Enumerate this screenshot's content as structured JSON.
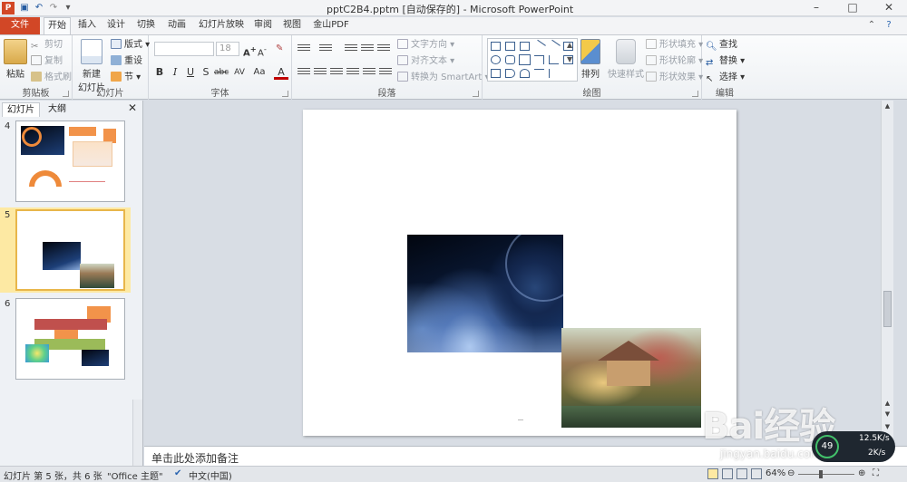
{
  "titlebar": {
    "title": "pptC2B4.pptm [自动保存的] - Microsoft PowerPoint",
    "app_icon": "P"
  },
  "tabs": [
    "文件",
    "开始",
    "插入",
    "设计",
    "切换",
    "动画",
    "幻灯片放映",
    "审阅",
    "视图",
    "金山PDF"
  ],
  "ribbon": {
    "clipboard": {
      "paste": "粘贴",
      "cut": "剪切",
      "copy": "复制",
      "format_painter": "格式刷",
      "label": "剪贴板"
    },
    "slides": {
      "new_slide": "新建",
      "new_slide_2": "幻灯片",
      "layout": "版式",
      "reset": "重设",
      "section": "节",
      "label": "幻灯片"
    },
    "font": {
      "size": "18",
      "label": "字体",
      "bold": "B",
      "italic": "I",
      "underline": "U",
      "shadow": "S",
      "strike": "abc",
      "spacing": "AV",
      "case": "Aa",
      "color": "A"
    },
    "paragraph": {
      "text_direction": "文字方向",
      "align_text": "对齐文本",
      "smartart": "转换为 SmartArt",
      "label": "段落"
    },
    "drawing": {
      "arrange": "排列",
      "quick_styles": "快速样式",
      "shape_fill": "形状填充",
      "shape_outline": "形状轮廓",
      "shape_effects": "形状效果",
      "label": "绘图"
    },
    "editing": {
      "find": "查找",
      "replace": "替换",
      "select": "选择",
      "label": "编辑"
    }
  },
  "left_panel": {
    "tab_slides": "幻灯片",
    "tab_outline": "大纲",
    "thumbnails": [
      {
        "number": "4",
        "selected": false
      },
      {
        "number": "5",
        "selected": true
      },
      {
        "number": "6",
        "selected": false
      }
    ]
  },
  "notes": {
    "placeholder": "单击此处添加备注"
  },
  "statusbar": {
    "slide_info": "幻灯片 第 5 张，共 6 张",
    "theme": "\"Office 主题\"",
    "language": "中文(中国)",
    "zoom": "64%"
  },
  "watermark": {
    "brand": "Bai经验",
    "domain": "jingyan.baidu.com"
  },
  "network_widget": {
    "percent": "49",
    "upload": "12.5K/s",
    "download": "2K/s"
  },
  "colors": {
    "file_tab": "#d24726",
    "ribbon_bg": "#f3f4f6",
    "selected_thumb": "#fde9a3"
  }
}
